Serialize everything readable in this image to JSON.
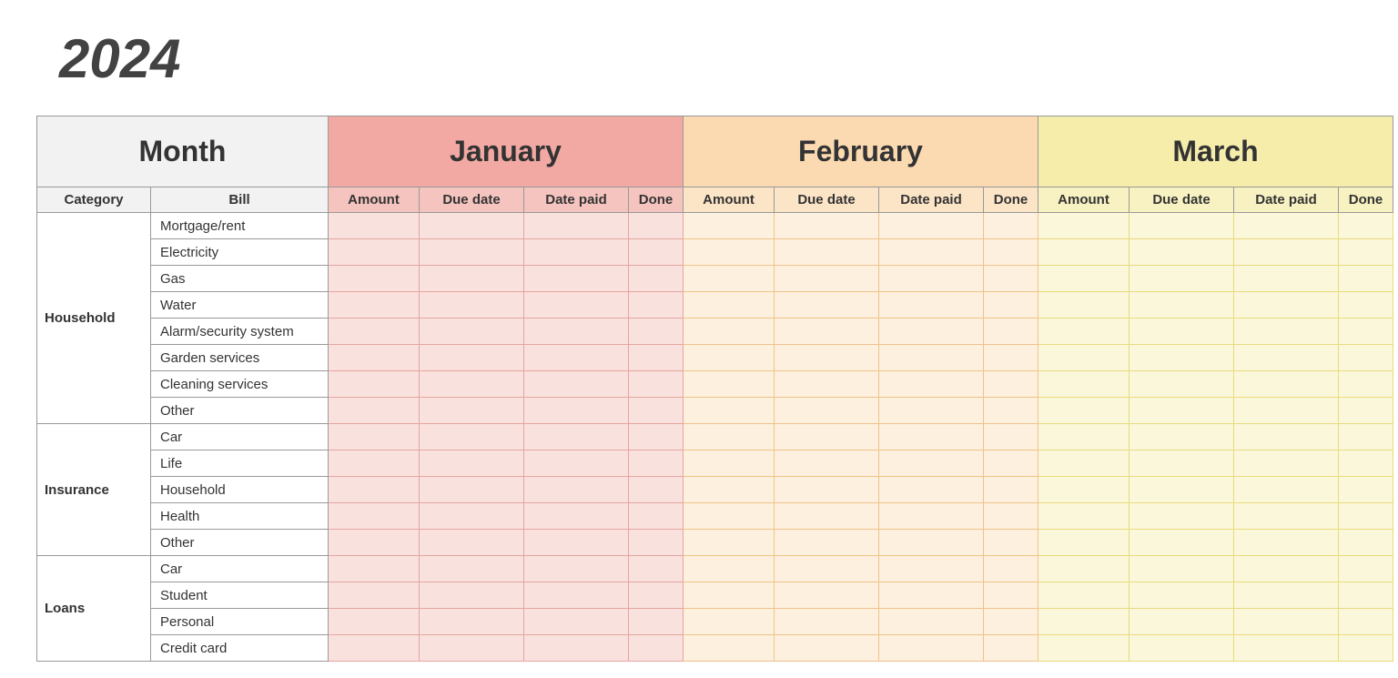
{
  "year": "2024",
  "left_header": "Month",
  "sub_left": {
    "category": "Category",
    "bill": "Bill"
  },
  "sub_month_cols": [
    "Amount",
    "Due date",
    "Date paid",
    "Done"
  ],
  "months": [
    "January",
    "February",
    "March"
  ],
  "groups": [
    {
      "category": "Household",
      "bills": [
        "Mortgage/rent",
        "Electricity",
        "Gas",
        "Water",
        "Alarm/security system",
        "Garden services",
        "Cleaning services",
        "Other"
      ]
    },
    {
      "category": "Insurance",
      "bills": [
        "Car",
        "Life",
        "Household",
        "Health",
        "Other"
      ]
    },
    {
      "category": "Loans",
      "bills": [
        "Car",
        "Student",
        "Personal",
        "Credit card"
      ]
    }
  ]
}
